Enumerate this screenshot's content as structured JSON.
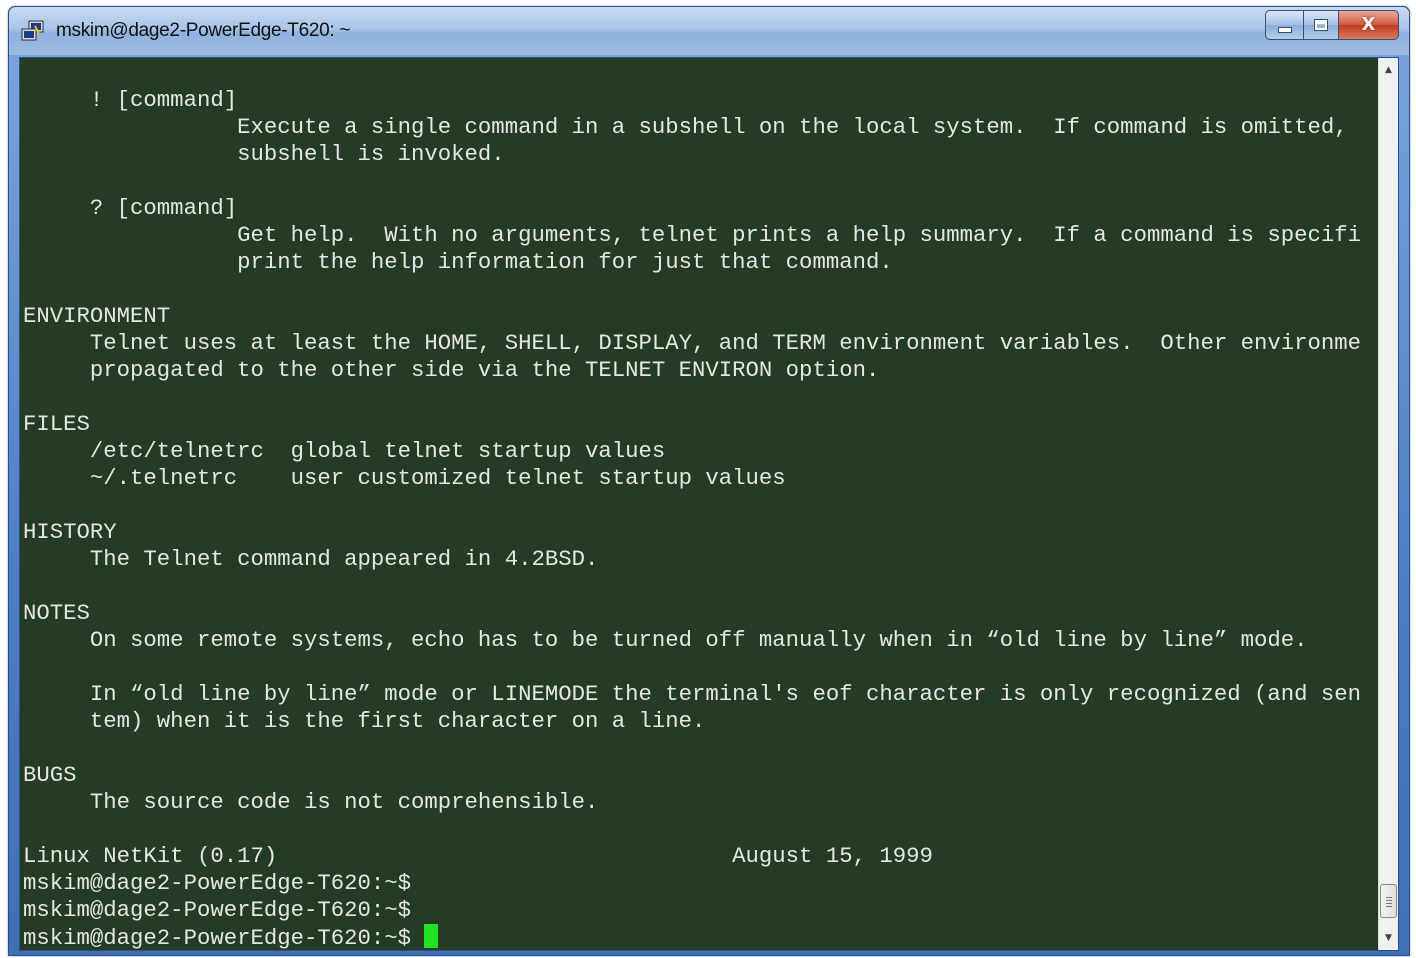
{
  "window": {
    "title": "mskim@dage2-PowerEdge-T620: ~",
    "icons": {
      "app": "putty-icon",
      "minimize": "minimize-icon",
      "maximize": "maximize-icon",
      "close": "close-icon"
    },
    "close_glyph": "X"
  },
  "terminal": {
    "cursor_color": "#22e222",
    "background": "#243c24",
    "lines": [
      "     ! [command]",
      "                Execute a single command in a subshell on the local system.  If command is omitted,",
      "                subshell is invoked.",
      "",
      "     ? [command]",
      "                Get help.  With no arguments, telnet prints a help summary.  If a command is specifi",
      "                print the help information for just that command.",
      "",
      "ENVIRONMENT",
      "     Telnet uses at least the HOME, SHELL, DISPLAY, and TERM environment variables.  Other environme",
      "     propagated to the other side via the TELNET ENVIRON option.",
      "",
      "FILES",
      "     /etc/telnetrc  global telnet startup values",
      "     ~/.telnetrc    user customized telnet startup values",
      "",
      "HISTORY",
      "     The Telnet command appeared in 4.2BSD.",
      "",
      "NOTES",
      "     On some remote systems, echo has to be turned off manually when in “old line by line” mode.",
      "",
      "     In “old line by line” mode or LINEMODE the terminal's eof character is only recognized (and sen",
      "     tem) when it is the first character on a line.",
      "",
      "BUGS",
      "     The source code is not comprehensible.",
      "",
      "Linux NetKit (0.17)                                  August 15, 1999",
      "mskim@dage2-PowerEdge-T620:~$",
      "mskim@dage2-PowerEdge-T620:~$",
      "mskim@dage2-PowerEdge-T620:~$ "
    ]
  },
  "scrollbar": {
    "position_fraction": 1.0
  }
}
